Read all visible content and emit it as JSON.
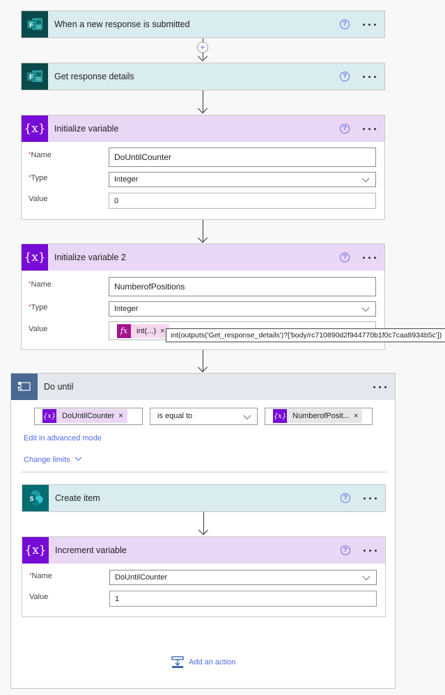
{
  "steps": {
    "trigger": {
      "title": "When a new response is submitted",
      "help": "?"
    },
    "get_response": {
      "title": "Get response details",
      "help": "?"
    },
    "init_var1": {
      "title": "Initialize variable",
      "help": "?",
      "fields": {
        "name_label": "Name",
        "name_value": "DoUntilCounter",
        "type_label": "Type",
        "type_value": "Integer",
        "value_label": "Value",
        "value_value": "0"
      }
    },
    "init_var2": {
      "title": "Initialize variable 2",
      "help": "?",
      "fields": {
        "name_label": "Name",
        "name_value": "NumberofPositions",
        "type_label": "Type",
        "type_value": "Integer",
        "value_label": "Value",
        "value_token": "int(...)"
      },
      "tooltip": "int(outputs('Get_response_details')?['body/rc710890d2f944770b1f0c7caa8934b5c'])"
    },
    "do_until": {
      "title": "Do until",
      "condition": {
        "left_token": "DoUntilCounter",
        "operator": "is equal to",
        "right_token": "NumberofPosit..."
      },
      "advanced_link": "Edit in advanced mode",
      "limits_link": "Change limits",
      "add_action": "Add an action"
    },
    "create_item": {
      "title": "Create item",
      "help": "?"
    },
    "increment": {
      "title": "Increment variable",
      "help": "?",
      "fields": {
        "name_label": "Name",
        "name_value": "DoUntilCounter",
        "value_label": "Value",
        "value_value": "1"
      }
    }
  },
  "glyphs": {
    "required": "*",
    "close": "×",
    "plus": "+",
    "var": "{x}",
    "fx": "fx",
    "forms_letter": "F",
    "sp_letter": "S"
  },
  "colors": {
    "forms": "#0b4a4a",
    "variable": "#770bd6",
    "loop": "#486991",
    "sharepoint": "#036c70",
    "link": "#4f6bed",
    "expression": "#a4138a"
  }
}
